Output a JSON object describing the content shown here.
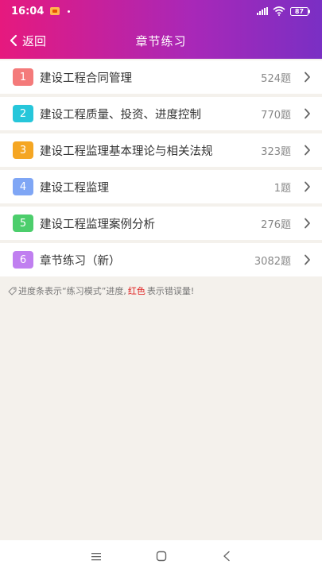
{
  "status_bar": {
    "time": "16:04",
    "battery": "87"
  },
  "header": {
    "back_label": "返回",
    "title": "章节练习"
  },
  "chapters": [
    {
      "number": "1",
      "title": "建设工程合同管理",
      "count": "524题",
      "color": "#f47a7a"
    },
    {
      "number": "2",
      "title": "建设工程质量、投资、进度控制",
      "count": "770题",
      "color": "#26c6da"
    },
    {
      "number": "3",
      "title": "建设工程监理基本理论与相关法规",
      "count": "323题",
      "color": "#f5a623"
    },
    {
      "number": "4",
      "title": "建设工程监理",
      "count": "1题",
      "color": "#7fa6f5"
    },
    {
      "number": "5",
      "title": "建设工程监理案例分析",
      "count": "276题",
      "color": "#4cce6c"
    },
    {
      "number": "6",
      "title": "章节练习（新）",
      "count": "3082题",
      "color": "#c07ff0"
    }
  ],
  "hint": {
    "prefix": "进度条表示“练习模式”进度,",
    "red": "红色",
    "suffix": "表示错误量!"
  },
  "icons": {
    "back": "chevron-left-icon",
    "row_arrow": "chevron-right-icon",
    "hint": "tag-icon",
    "nav": [
      "menu-icon",
      "home-square-icon",
      "back-triangle-icon"
    ]
  }
}
